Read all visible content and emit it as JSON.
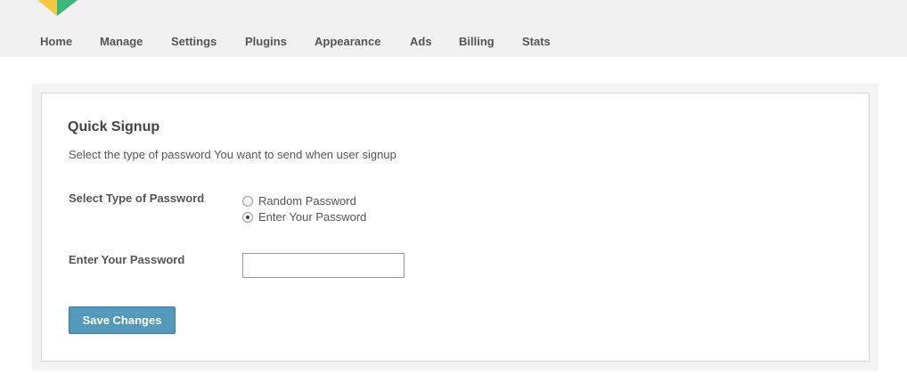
{
  "nav": {
    "items": [
      {
        "label": "Home"
      },
      {
        "label": "Manage"
      },
      {
        "label": "Settings"
      },
      {
        "label": "Plugins"
      },
      {
        "label": "Appearance"
      },
      {
        "label": "Ads"
      },
      {
        "label": "Billing"
      },
      {
        "label": "Stats"
      }
    ]
  },
  "panel": {
    "title": "Quick Signup",
    "description": "Select the type of password You want to send when user signup",
    "password_type": {
      "label": "Select Type of Password",
      "options": [
        {
          "label": "Random Password",
          "checked": false
        },
        {
          "label": "Enter Your Password",
          "checked": true
        }
      ]
    },
    "password_field": {
      "label": "Enter Your Password",
      "value": "",
      "placeholder": ""
    },
    "save_label": "Save Changes"
  },
  "colors": {
    "topbar_bg": "#f1f1f1",
    "button_bg": "#5499b9",
    "text": "#555555"
  }
}
